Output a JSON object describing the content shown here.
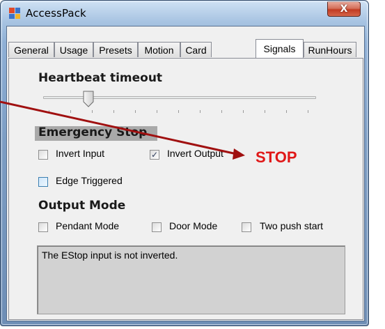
{
  "window": {
    "title": "AccessPack",
    "close_glyph": "X"
  },
  "tabs": [
    {
      "label": "General"
    },
    {
      "label": "Usage"
    },
    {
      "label": "Presets"
    },
    {
      "label": "Motion"
    },
    {
      "label": "Card"
    },
    {
      "label": "Signals",
      "active": true
    },
    {
      "label": "RunHours"
    }
  ],
  "heartbeat": {
    "heading": "Heartbeat timeout",
    "slider_level": 0.13
  },
  "emergency_stop": {
    "heading": "Emergency Stop",
    "invert_input": {
      "label": "Invert Input",
      "checked": false
    },
    "invert_output": {
      "label": "Invert Output",
      "checked": true
    },
    "edge_triggered": {
      "label": "Edge Triggered",
      "checked": false
    }
  },
  "annotation": {
    "stop_text": "STOP",
    "color": "#e01818",
    "arrow_color": "#a01010"
  },
  "output_mode": {
    "heading": "Output Mode",
    "pendant_mode": {
      "label": "Pendant Mode",
      "checked": false
    },
    "door_mode": {
      "label": "Door Mode",
      "checked": false
    },
    "two_push_start": {
      "label": "Two push start",
      "checked": false
    }
  },
  "status": {
    "text": "The EStop input is not inverted."
  },
  "icons": {
    "app": "app-icon",
    "close": "close-icon",
    "check": "checkmark-icon"
  }
}
